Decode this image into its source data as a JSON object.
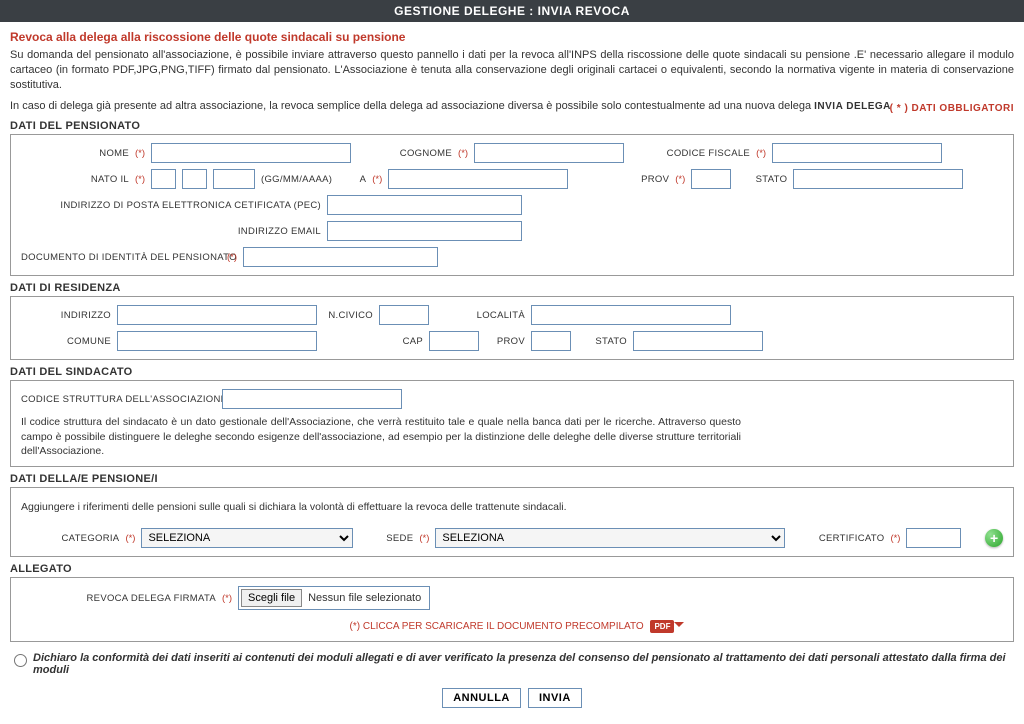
{
  "header": {
    "title": "GESTIONE DELEGHE : INVIA REVOCA"
  },
  "intro": {
    "heading": "Revoca alla delega alla riscossione delle quote sindacali su pensione",
    "para1": "Su domanda del pensionato all'associazione, è possibile inviare attraverso questo pannello i dati per la revoca all'INPS della riscossione delle quote sindacali su pensione .E' necessario allegare il modulo cartaceo (in formato PDF,JPG,PNG,TIFF) firmato dal pensionato. L'Associazione è tenuta alla conservazione degli originali cartacei o equivalenti, secondo la normativa vigente in materia di conservazione sostitutiva.",
    "para2a": "In caso di delega già presente ad altra associazione, la revoca semplice della delega ad associazione diversa è possibile solo contestualmente ad una nuova delega ",
    "para2_link": "INVIA DELEGA",
    "obbl": "( * ) DATI OBBLIGATORI"
  },
  "sections": {
    "pensionato": "DATI DEL PENSIONATO",
    "residenza": "DATI DI RESIDENZA",
    "sindacato": "DATI DEL SINDACATO",
    "pensioni": "DATI DELLA/E PENSIONE/I",
    "allegato": "ALLEGATO"
  },
  "labels": {
    "nome": "NOME",
    "cognome": "COGNOME",
    "cf": "CODICE FISCALE",
    "natoil": "NATO IL",
    "natofmt": "(GG/MM/AAAA)",
    "a": "A",
    "prov": "PROV",
    "stato": "STATO",
    "pec": "INDIRIZZO DI POSTA ELETTRONICA CETIFICATA (PEC)",
    "email": "INDIRIZZO EMAIL",
    "docid": "DOCUMENTO DI IDENTITÀ DEL PENSIONATO",
    "indirizzo": "INDIRIZZO",
    "ncivico": "N.CIVICO",
    "localita": "LOCALITÀ",
    "comune": "COMUNE",
    "cap": "CAP",
    "codstrutt": "CODICE STRUTTURA DELL'ASSOCIAZIONE",
    "categoria": "CATEGORIA",
    "sede": "SEDE",
    "certificato": "CERTIFICATO",
    "revocafile": "REVOCA DELEGA FIRMATA",
    "req": "(*)"
  },
  "sindacato_note": "Il codice struttura del sindacato è un dato gestionale dell'Associazione, che verrà restituito tale e quale nella banca dati per le ricerche. Attraverso questo campo è possibile distinguere le deleghe secondo esigenze dell'associazione, ad esempio per la distinzione delle deleghe delle diverse strutture territoriali dell'Associazione.",
  "pensioni_note": "Aggiungere i riferimenti delle pensioni sulle quali si dichiara la volontà di effettuare la revoca delle trattenute sindacali.",
  "selects": {
    "categoria_sel": "SELEZIONA",
    "sede_sel": "SELEZIONA"
  },
  "file": {
    "btn": "Scegli file",
    "none": "Nessun file selezionato"
  },
  "download": {
    "prefix": "(*) ",
    "text": "CLICCA PER SCARICARE IL DOCUMENTO PRECOMPILATO",
    "badge": "PDF"
  },
  "declare": "Dichiaro la conformità dei dati inseriti ai contenuti dei moduli allegati e di aver verificato la presenza del consenso del pensionato al trattamento dei dati personali attestato dalla firma dei moduli",
  "buttons": {
    "annulla": "ANNULLA",
    "invia": "INVIA"
  }
}
